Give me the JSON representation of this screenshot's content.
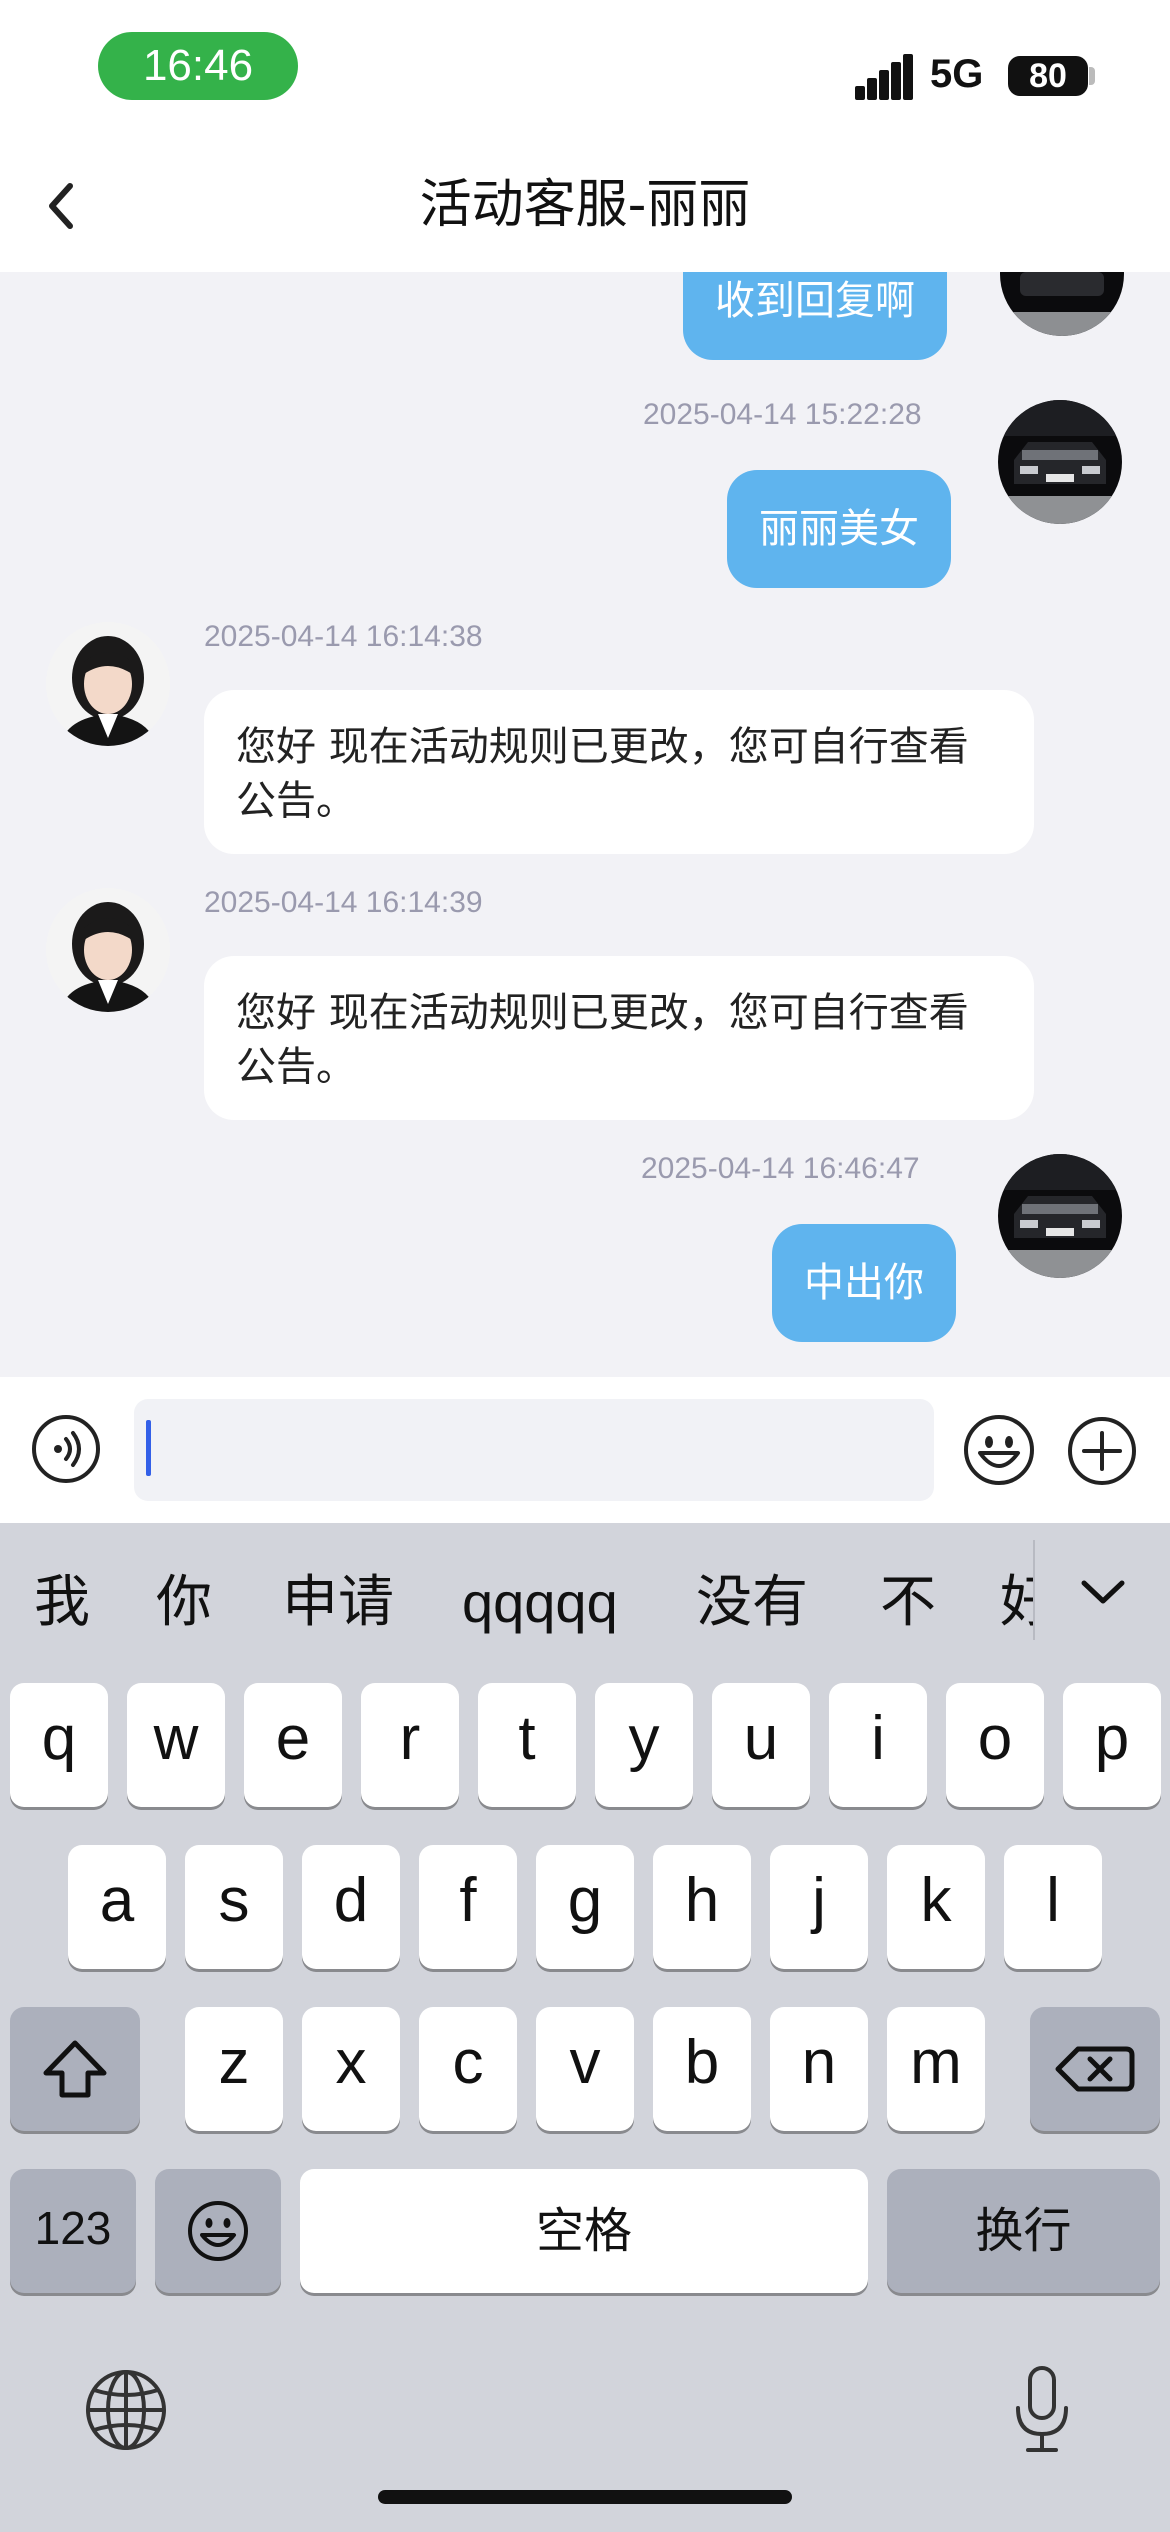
{
  "status_bar": {
    "time": "16:46",
    "network": "5G",
    "battery": "80"
  },
  "nav": {
    "title": "活动客服-丽丽"
  },
  "messages": [
    {
      "type": "out",
      "text": "收到回复啊"
    },
    {
      "type": "out",
      "timestamp": "2025-04-14 15:22:28",
      "text": "丽丽美女"
    },
    {
      "type": "in",
      "timestamp": "2025-04-14 16:14:38",
      "text": "您好 现在活动规则已更改，您可自行查看公告。"
    },
    {
      "type": "in",
      "timestamp": "2025-04-14 16:14:39",
      "text": "您好 现在活动规则已更改，您可自行查看公告。"
    },
    {
      "type": "out",
      "timestamp": "2025-04-14 16:46:47",
      "text": "中出你"
    }
  ],
  "input": {
    "value": ""
  },
  "keyboard": {
    "candidates": [
      "我",
      "你",
      "申请",
      "qqqqq",
      "没有",
      "不",
      "好"
    ],
    "row1": [
      "q",
      "w",
      "e",
      "r",
      "t",
      "y",
      "u",
      "i",
      "o",
      "p"
    ],
    "row2": [
      "a",
      "s",
      "d",
      "f",
      "g",
      "h",
      "j",
      "k",
      "l"
    ],
    "row3": [
      "z",
      "x",
      "c",
      "v",
      "b",
      "n",
      "m"
    ],
    "numbers_label": "123",
    "space_label": "空格",
    "return_label": "换行"
  },
  "colors": {
    "outgoing_bubble": "#5fb4ee",
    "time_pill": "#34b24a",
    "caret": "#3360e8"
  }
}
